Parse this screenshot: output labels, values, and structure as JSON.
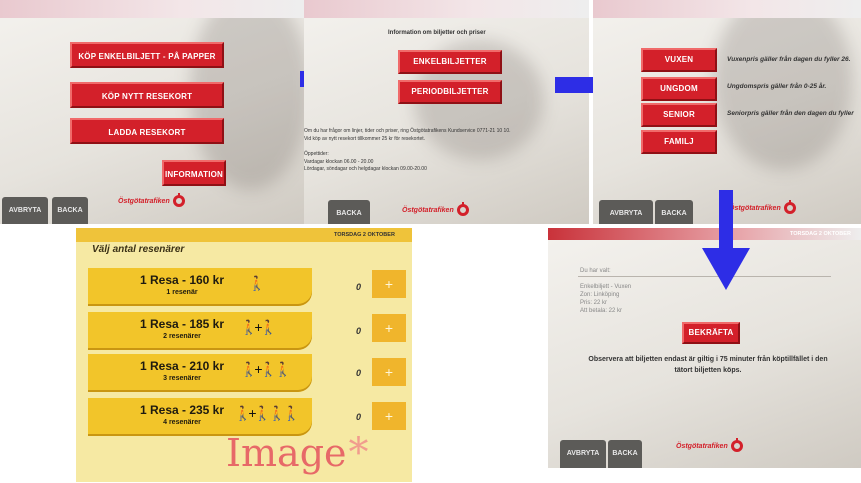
{
  "screen1": {
    "buttons": [
      "KÖP ENKELBILJETT - PÅ PAPPER",
      "KÖP NYTT RESEKORT",
      "LADDA RESEKORT"
    ],
    "info_button": "INFORMATION",
    "footer": {
      "cancel": "AVBRYTA",
      "back": "BACKA"
    },
    "logo": "Östgötatrafiken"
  },
  "screen2": {
    "header": "Information om biljetter och priser",
    "buttons": [
      "ENKELBILJETTER",
      "PERIODBILJETTER"
    ],
    "info_lines": [
      "Om du har frågor om linjer, tider och priser, ring Östgötatrafikens Kundservice 0771-21 10 10.",
      "Vid köp av nytt resekort tillkommer 25 kr för resekortet.",
      "Öppettider:",
      "Vardagar klockan 06.00 - 20.00",
      "Lördagar, söndagar och helgdagar klockan 09.00-20.00"
    ],
    "footer": {
      "back": "BACKA"
    },
    "logo": "Östgötatrafiken"
  },
  "screen3": {
    "options": [
      {
        "label": "VUXEN",
        "desc": "Vuxenpris gäller från dagen du fyller 26."
      },
      {
        "label": "UNGDOM",
        "desc": "Ungdomspris gäller från 0-25 år."
      },
      {
        "label": "SENIOR",
        "desc": "Seniorpris gäller från den dagen du fyller"
      },
      {
        "label": "FAMILJ",
        "desc": ""
      }
    ],
    "footer": {
      "cancel": "AVBRYTA",
      "back": "BACKA"
    },
    "logo": "Östgötatrafiken"
  },
  "screen4": {
    "date": "TORSDAG 2 OKTOBER",
    "title": "Välj antal resenärer",
    "options": [
      {
        "title": "1 Resa - 160 kr",
        "sub": "1 resenär",
        "persons": "🚶",
        "qty": "0"
      },
      {
        "title": "1 Resa - 185 kr",
        "sub": "2 resenärer",
        "persons": "🚶+🚶",
        "qty": "0"
      },
      {
        "title": "1 Resa - 210 kr",
        "sub": "3 resenärer",
        "persons": "🚶+🚶🚶",
        "qty": "0"
      },
      {
        "title": "1 Resa - 235 kr",
        "sub": "4 resenärer",
        "persons": "🚶+🚶🚶🚶",
        "qty": "0"
      }
    ],
    "plus_label": "+",
    "watermark": "Image"
  },
  "screen5": {
    "date": "TORSDAG 2 OKTOBER",
    "summary_header": "Du har valt:",
    "summary": [
      "Enkelbiljett - Vuxen",
      "Zon: Linköping",
      "Pris: 22 kr",
      "Att betala: 22 kr"
    ],
    "confirm": "BEKRÄFTA",
    "note": "Observera att biljetten endast är giltig i 75 minuter från köptillfället i den tätort biljetten köps.",
    "footer": {
      "cancel": "AVBRYTA",
      "back": "BACKA"
    },
    "logo": "Östgötatrafiken"
  },
  "colors": {
    "arrow": "#2d2de6",
    "red": "#d3202a",
    "yellow": "#f2c52a"
  }
}
